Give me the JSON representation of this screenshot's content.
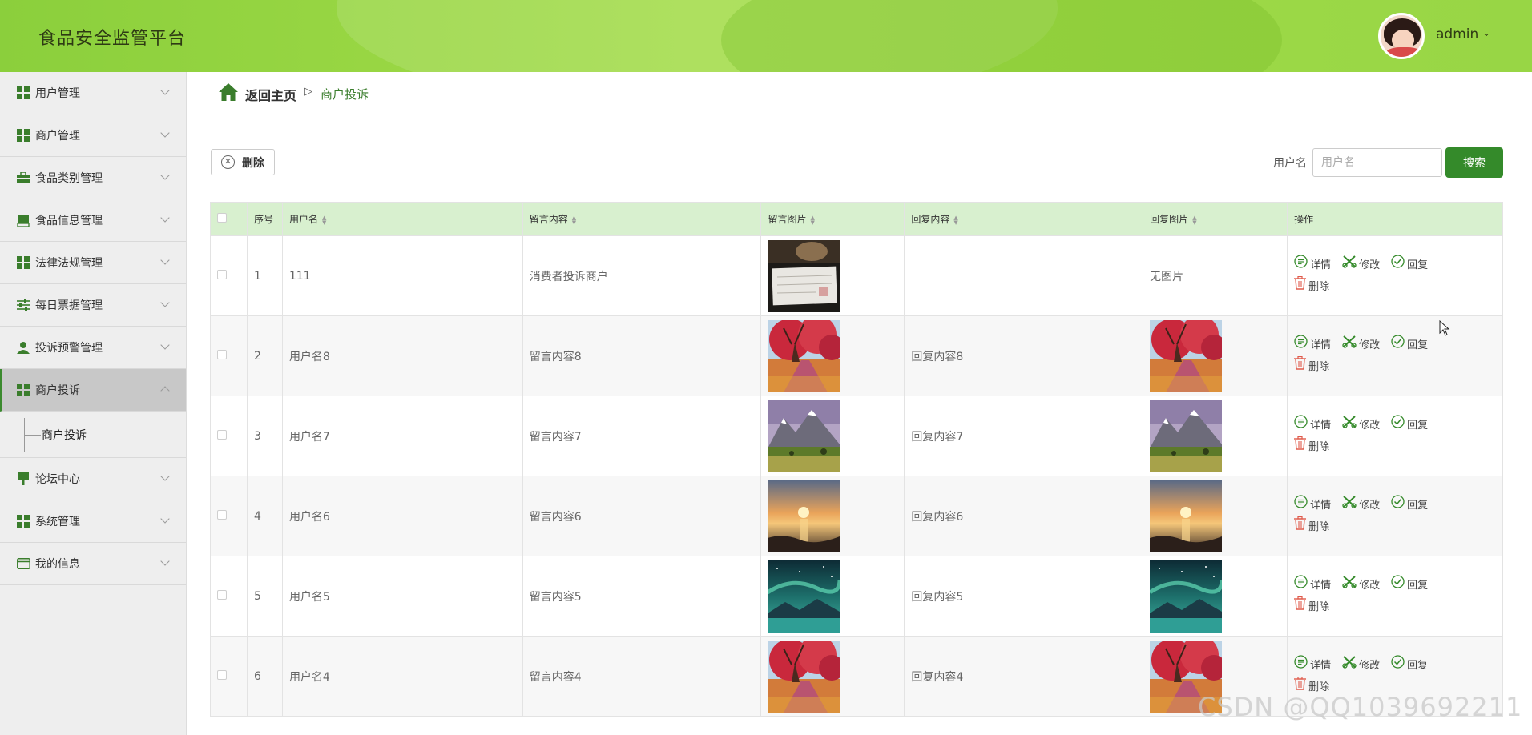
{
  "header": {
    "title": "食品安全监管平台",
    "user": "admin",
    "caret": "⌄"
  },
  "sidebar": {
    "items": [
      {
        "label": "用户管理",
        "icon": "grid-icon"
      },
      {
        "label": "商户管理",
        "icon": "grid-icon"
      },
      {
        "label": "食品类别管理",
        "icon": "briefcase-icon"
      },
      {
        "label": "食品信息管理",
        "icon": "book-icon"
      },
      {
        "label": "法律法规管理",
        "icon": "grid-icon"
      },
      {
        "label": "每日票据管理",
        "icon": "sliders-icon"
      },
      {
        "label": "投诉预警管理",
        "icon": "person-icon"
      },
      {
        "label": "商户投诉",
        "icon": "grid-icon",
        "active": true,
        "sub": [
          "商户投诉"
        ]
      },
      {
        "label": "论坛中心",
        "icon": "sign-icon"
      },
      {
        "label": "系统管理",
        "icon": "grid-icon"
      },
      {
        "label": "我的信息",
        "icon": "card-icon"
      }
    ]
  },
  "breadcrumb": {
    "home": "返回主页",
    "separator": "▷",
    "current": "商户投诉"
  },
  "toolbar": {
    "delete": "删除",
    "search_label": "用户名",
    "search_placeholder": "用户名",
    "search_button": "搜索"
  },
  "table": {
    "headers": [
      "序号",
      "用户名",
      "留言内容",
      "留言图片",
      "回复内容",
      "回复图片",
      "操作"
    ],
    "rows": [
      {
        "no": "1",
        "user": "111",
        "content": "消费者投诉商户",
        "img": "receipt",
        "reply": "",
        "reply_img": "无图片"
      },
      {
        "no": "2",
        "user": "用户名8",
        "content": "留言内容8",
        "img": "autumn",
        "reply": "回复内容8",
        "reply_img": "autumn"
      },
      {
        "no": "3",
        "user": "用户名7",
        "content": "留言内容7",
        "img": "mountain",
        "reply": "回复内容7",
        "reply_img": "mountain"
      },
      {
        "no": "4",
        "user": "用户名6",
        "content": "留言内容6",
        "img": "sunset",
        "reply": "回复内容6",
        "reply_img": "sunset"
      },
      {
        "no": "5",
        "user": "用户名5",
        "content": "留言内容5",
        "img": "aurora",
        "reply": "回复内容5",
        "reply_img": "aurora"
      },
      {
        "no": "6",
        "user": "用户名4",
        "content": "留言内容4",
        "img": "autumn",
        "reply": "回复内容4",
        "reply_img": "autumn"
      }
    ],
    "actions": {
      "detail": "详情",
      "edit": "修改",
      "reply": "回复",
      "delete": "删除"
    }
  },
  "watermark": "CSDN @QQ1039692211",
  "colors": {
    "accent": "#348a2a",
    "header": "#a3dc49",
    "table_header": "#d8f0cf"
  }
}
